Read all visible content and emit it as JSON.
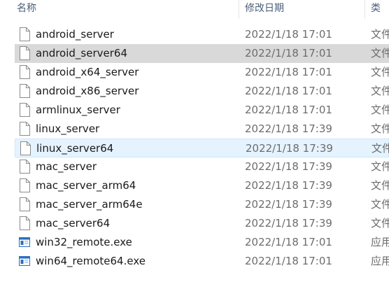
{
  "columns": {
    "name": "名称",
    "date": "修改日期",
    "type": "类"
  },
  "files": [
    {
      "name": "android_server",
      "date": "2022/1/18 17:01",
      "type": "文件",
      "icon": "file-icon"
    },
    {
      "name": "android_server64",
      "date": "2022/1/18 17:01",
      "type": "文件",
      "icon": "file-icon",
      "state": "selected"
    },
    {
      "name": "android_x64_server",
      "date": "2022/1/18 17:01",
      "type": "文件",
      "icon": "file-icon"
    },
    {
      "name": "android_x86_server",
      "date": "2022/1/18 17:01",
      "type": "文件",
      "icon": "file-icon"
    },
    {
      "name": "armlinux_server",
      "date": "2022/1/18 17:01",
      "type": "文件",
      "icon": "file-icon"
    },
    {
      "name": "linux_server",
      "date": "2022/1/18 17:39",
      "type": "文件",
      "icon": "file-icon"
    },
    {
      "name": "linux_server64",
      "date": "2022/1/18 17:39",
      "type": "文件",
      "icon": "file-icon",
      "state": "hover"
    },
    {
      "name": "mac_server",
      "date": "2022/1/18 17:39",
      "type": "文件",
      "icon": "file-icon"
    },
    {
      "name": "mac_server_arm64",
      "date": "2022/1/18 17:39",
      "type": "文件",
      "icon": "file-icon"
    },
    {
      "name": "mac_server_arm64e",
      "date": "2022/1/18 17:39",
      "type": "文件",
      "icon": "file-icon"
    },
    {
      "name": "mac_server64",
      "date": "2022/1/18 17:39",
      "type": "文件",
      "icon": "file-icon"
    },
    {
      "name": "win32_remote.exe",
      "date": "2022/1/18 17:01",
      "type": "应用",
      "icon": "exe-icon"
    },
    {
      "name": "win64_remote64.exe",
      "date": "2022/1/18 17:01",
      "type": "应用",
      "icon": "exe-icon"
    }
  ],
  "colors": {
    "selected_row": "#d9d9d9",
    "hover_row": "#e5f3ff",
    "header_text": "#4c607a"
  }
}
